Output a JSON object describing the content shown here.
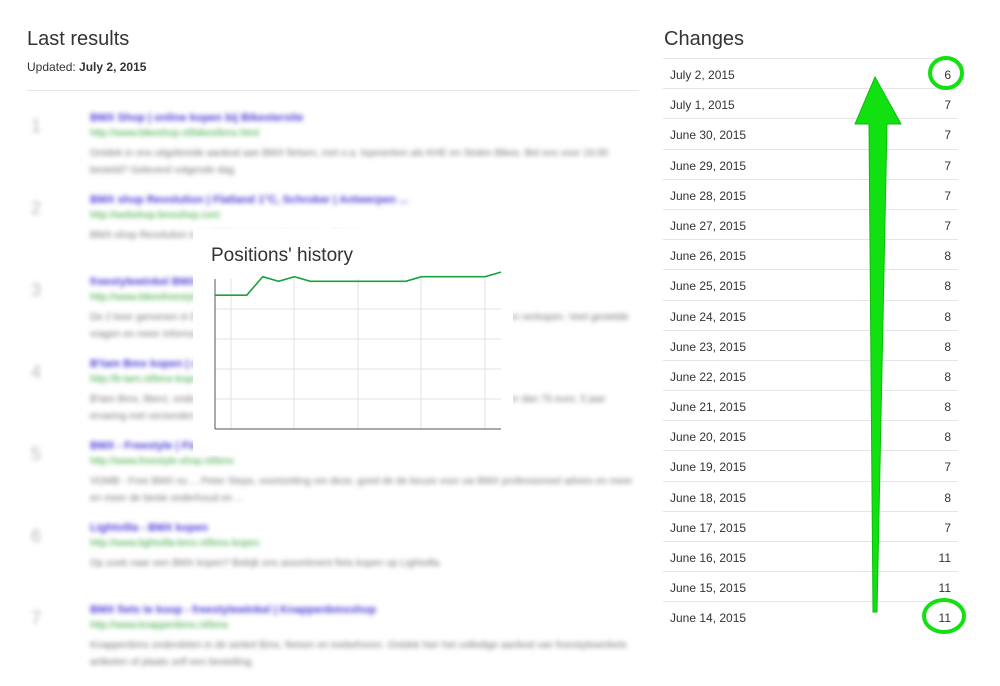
{
  "left": {
    "title": "Last results",
    "updated_label": "Updated:",
    "updated_date": "July 2, 2015"
  },
  "results": [
    {
      "num": "1",
      "title": "BMX Shop | online kopen bij Bikestersite",
      "url": "http://www.bikeshop.nl/bikes/bmx.html",
      "desc": "Ontdek in ons uitgebreide aanbod aan BMX fietsen, met o.a. topmerken als KHE en Stolen Bikes. Bel ons voor 16:00 besteld? Geleverd volgende dag."
    },
    {
      "num": "2",
      "title": "BMX shop Revolution | Flatland 1°C, Schroker | Antwerpen ...",
      "url": "http://webshop.bmxshop.com",
      "desc": "BMX-shop Revolution is de BMX-winkel in Antwerpen, Belgie."
    },
    {
      "num": "3",
      "title": "freestylewinkel BMX kopen",
      "url": "http://www.bikesfreestyle.nl",
      "desc": "De 2 keer genomen in BMX-shop, bekijk het hele aanbod met BMX onderdelen, fietsen kopen en verkopen. Veel gestelde vragen en meer informatie over alles."
    },
    {
      "num": "4",
      "title": "B'tam Bmx kopen | online bestellen",
      "url": "http://b-tam.nl/bmx-kopen",
      "desc": "B'tam Bmx, liberz, onderdelen en meer voor beginners en gevorderden. Gratis levering van meer dan 75 euro. 5 jaar ervaring met verzenden."
    },
    {
      "num": "5",
      "title": "BMX - Freestyle | Fietsen bestellen",
      "url": "http://www.freestyle-shop.nl/bmx",
      "desc": "VOMB - Free BMX nu ... Peter Steps, voortzetting om deze, goed de de keuze voor uw BMX professioneel advies en meer en meer de beste onderhoud en ..."
    },
    {
      "num": "6",
      "title": "Lightvilla - BMX kopen",
      "url": "http://www.lightvilla-bmx.nl/bmx-kopen",
      "desc": "Op zoek naar een BMX kopen? Bekijk ons assortiment fiets kopen op Lightvilla."
    },
    {
      "num": "7",
      "title": "BMX fiets te koop - freestylewinkel | Knappenbmxshop",
      "url": "http://www.knappenbmx.nl/bmx",
      "desc": "Knappenbmx onderdelen in de winkel Bmx, fietsen en toebehoren. Ontdek hier het volledige aanbod van freestylewinkels artikelen of plaats zelf een bestelling."
    }
  ],
  "history": {
    "title": "Positions' history"
  },
  "chart_data": {
    "type": "line",
    "title": "Positions' history",
    "x": [
      "June 14, 2015",
      "June 15, 2015",
      "June 16, 2015",
      "June 17, 2015",
      "June 18, 2015",
      "June 19, 2015",
      "June 20, 2015",
      "June 21, 2015",
      "June 22, 2015",
      "June 23, 2015",
      "June 24, 2015",
      "June 25, 2015",
      "June 26, 2015",
      "June 27, 2015",
      "June 28, 2015",
      "June 29, 2015",
      "June 30, 2015",
      "July 1, 2015",
      "July 2, 2015"
    ],
    "values": [
      11,
      11,
      11,
      7,
      8,
      7,
      8,
      8,
      8,
      8,
      8,
      8,
      8,
      7,
      7,
      7,
      7,
      7,
      6
    ],
    "y_inverted": true,
    "ylim": [
      7.5,
      40
    ],
    "grid": true,
    "line_color": "#1aa23e"
  },
  "changes": {
    "title": "Changes",
    "rows": [
      {
        "date": "July 2, 2015",
        "value": "6"
      },
      {
        "date": "July 1, 2015",
        "value": "7"
      },
      {
        "date": "June 30, 2015",
        "value": "7"
      },
      {
        "date": "June 29, 2015",
        "value": "7"
      },
      {
        "date": "June 28, 2015",
        "value": "7"
      },
      {
        "date": "June 27, 2015",
        "value": "7"
      },
      {
        "date": "June 26, 2015",
        "value": "8"
      },
      {
        "date": "June 25, 2015",
        "value": "8"
      },
      {
        "date": "June 24, 2015",
        "value": "8"
      },
      {
        "date": "June 23, 2015",
        "value": "8"
      },
      {
        "date": "June 22, 2015",
        "value": "8"
      },
      {
        "date": "June 21, 2015",
        "value": "8"
      },
      {
        "date": "June 20, 2015",
        "value": "8"
      },
      {
        "date": "June 19, 2015",
        "value": "7"
      },
      {
        "date": "June 18, 2015",
        "value": "8"
      },
      {
        "date": "June 17, 2015",
        "value": "7"
      },
      {
        "date": "June 16, 2015",
        "value": "11"
      },
      {
        "date": "June 15, 2015",
        "value": "11"
      },
      {
        "date": "June 14, 2015",
        "value": "11"
      }
    ]
  },
  "annotation": {
    "color": "#11e011",
    "icon": "up-arrow-icon"
  }
}
